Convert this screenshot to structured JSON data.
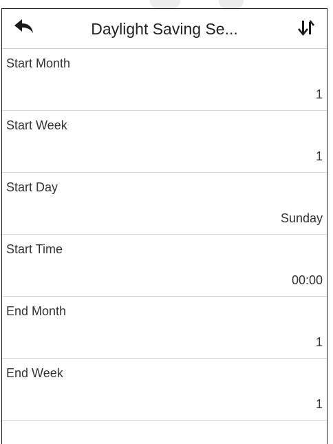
{
  "header": {
    "title": "Daylight Saving Se...",
    "back_icon": "back-arrow-icon",
    "sort_icon": "sort-arrows-icon"
  },
  "settings": [
    {
      "label": "Start Month",
      "value": "1"
    },
    {
      "label": "Start Week",
      "value": "1"
    },
    {
      "label": "Start Day",
      "value": "Sunday"
    },
    {
      "label": "Start Time",
      "value": "00:00"
    },
    {
      "label": "End Month",
      "value": "1"
    },
    {
      "label": "End Week",
      "value": "1"
    }
  ]
}
